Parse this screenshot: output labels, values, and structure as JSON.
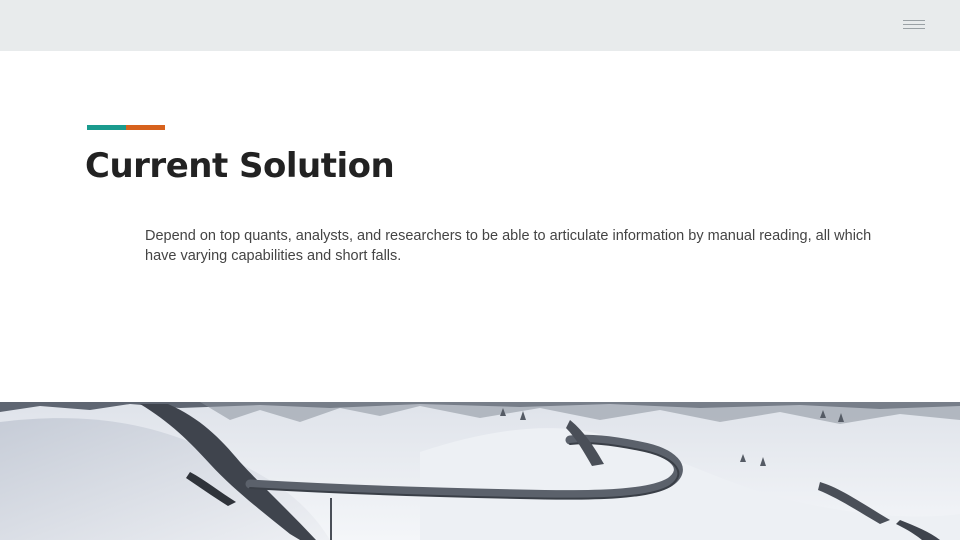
{
  "header": {
    "menu_icon": "hamburger-menu-icon",
    "background_color": "#e8ebec"
  },
  "slide": {
    "accent_colors": [
      "#1a9b8e",
      "#d7621d"
    ],
    "title": "Current Solution",
    "body": "Depend on top quants, analysts, and researchers to be able to articulate information by manual reading, all which have varying capabilities and short falls."
  },
  "photo": {
    "subject": "snowy mountain road"
  }
}
